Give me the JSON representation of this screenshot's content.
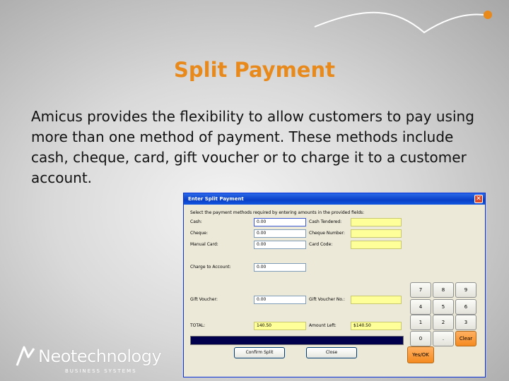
{
  "slide": {
    "title": "Split Payment",
    "body": "Amicus provides the flexibility to allow customers to pay using more than one method of payment. These methods include cash, cheque, card, gift voucher or to charge it to a customer account."
  },
  "dialog": {
    "title": "Enter Split Payment",
    "close_glyph": "✕",
    "instruction": "Select the payment methods required by entering amounts in the provided fields:",
    "fields": {
      "cash_label": "Cash:",
      "cash_value": "0.00",
      "cheque_label": "Cheque:",
      "cheque_value": "0.00",
      "manual_card_label": "Manual Card:",
      "manual_card_value": "0.00",
      "charge_label": "Charge to Account:",
      "charge_value": "0.00",
      "gift_voucher_label": "Gift Voucher:",
      "gift_voucher_value": "0.00",
      "cash_tendered_label": "Cash Tendered:",
      "cash_tendered_value": "",
      "cheque_number_label": "Cheque Number:",
      "cheque_number_value": "",
      "card_code_label": "Card Code:",
      "card_code_value": "",
      "gift_voucher_no_label": "Gift Voucher No.:",
      "gift_voucher_no_value": "",
      "total_label": "TOTAL:",
      "total_value": "140.50",
      "amount_left_label": "Amount Left:",
      "amount_left_value": "$140.50"
    },
    "keypad": [
      "7",
      "8",
      "9",
      "4",
      "5",
      "6",
      "1",
      "2",
      "3",
      "0",
      ".",
      "Clear"
    ],
    "yes_ok_label": "Yes/OK",
    "confirm_label": "Confirm Split",
    "close_label": "Close"
  },
  "logo": {
    "name": "Neotechnology",
    "tagline": "BUSINESS SYSTEMS"
  },
  "colors": {
    "title": "#e8891b",
    "titlebar": "#0a3fc7",
    "field_highlight": "#ffff99",
    "accent_orange": "#f58a1f"
  }
}
